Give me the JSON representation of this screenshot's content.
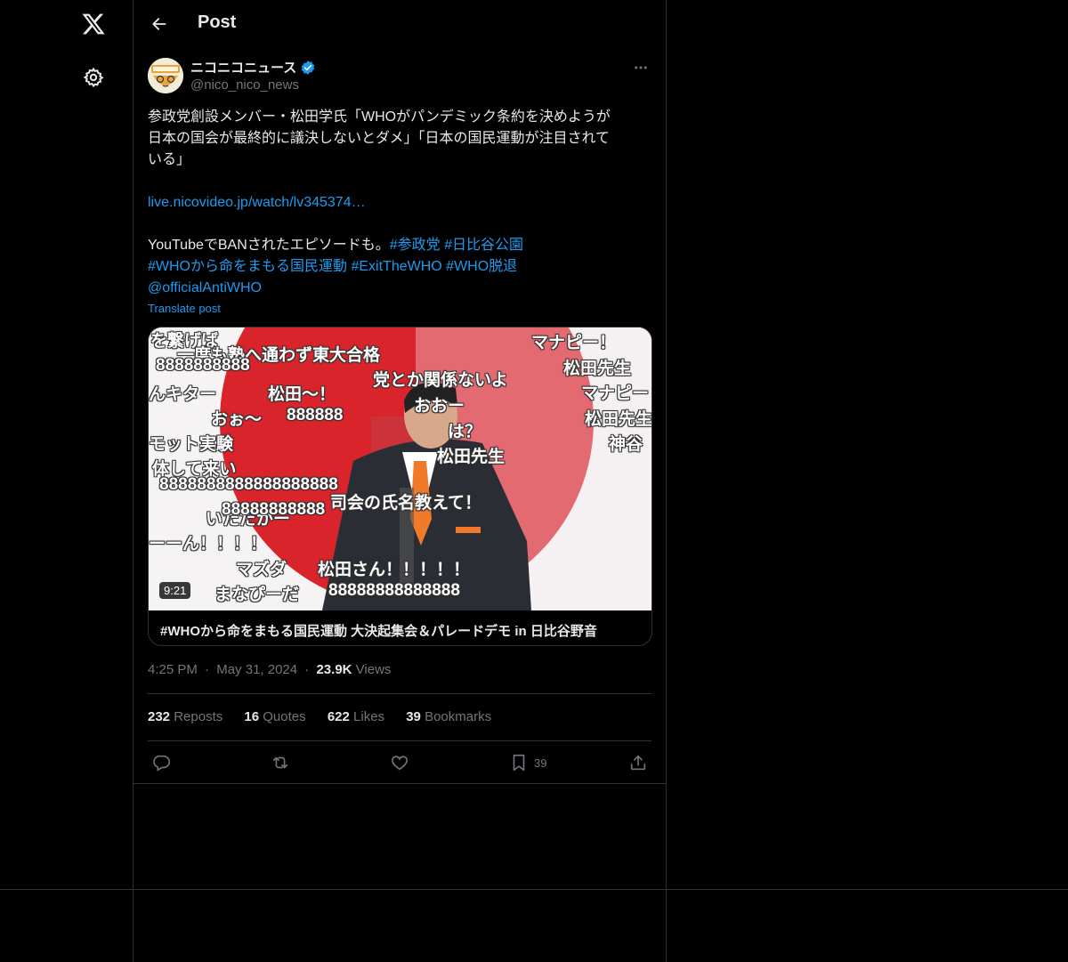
{
  "header": {
    "title": "Post"
  },
  "post": {
    "author_name": "ニコニコニュース",
    "handle": "@nico_nico_news",
    "text_lines": [
      "参政党創設メンバー・松田学氏「WHOがパンデミック条約を決めようが",
      "日本の国会が最終的に議決しないとダメ」「日本の国民運動が注目されて",
      "いる」"
    ],
    "link": "live.nicovideo.jp/watch/lv345374…",
    "line5_text": "YouTubeでBANされたエピソードも。",
    "hashtags_line5": [
      "#参政党",
      "#日比谷公園"
    ],
    "hashtags_line6": [
      "#WHOから命をまもる国民運動",
      "#ExitTheWHO",
      "#WHO脱退"
    ],
    "mention": "@officialAntiWHO",
    "translate": "Translate post",
    "card": {
      "duration": "9:21",
      "title": "#WHOから命をまもる国民運動 大決起集会＆パレードデモ in 日比谷野音",
      "comments": [
        "を繋げば",
        "一度も塾へ通わず東大合格",
        "8888888888",
        "んキター",
        "松田～！",
        "党とか関係ないよ",
        "おぉ～",
        "888888",
        "おおー",
        "は？",
        "モット実験",
        "体して来い",
        "松田先生",
        "8888888888888888888",
        "司会の氏名教えて！",
        "いただがー",
        "88888888888",
        "ーーん！！！！",
        "マズダ",
        "松田さん！！！！！",
        "まなぴーだ",
        "88888888888888",
        "マナピー！",
        "松田先生",
        "マナピー",
        "松田先生",
        "神谷"
      ]
    },
    "time": "4:25 PM",
    "date": "May 31, 2024",
    "views_count": "23.9K",
    "views_label": "Views",
    "stats": {
      "reposts_count": "232",
      "reposts_label": "Reposts",
      "quotes_count": "16",
      "quotes_label": "Quotes",
      "likes_count": "622",
      "likes_label": "Likes",
      "bookmarks_count": "39",
      "bookmarks_label": "Bookmarks"
    },
    "bookmark_action_count": "39"
  },
  "colors": {
    "accent": "#1d9bf0",
    "background": "#000000",
    "muted": "#71767b",
    "border": "#2f3336"
  },
  "icons": [
    "x-logo-icon",
    "settings-icon",
    "back-arrow-icon",
    "verified-badge-icon",
    "more-icon",
    "reply-icon",
    "repost-icon",
    "like-icon",
    "bookmark-icon",
    "share-icon"
  ]
}
